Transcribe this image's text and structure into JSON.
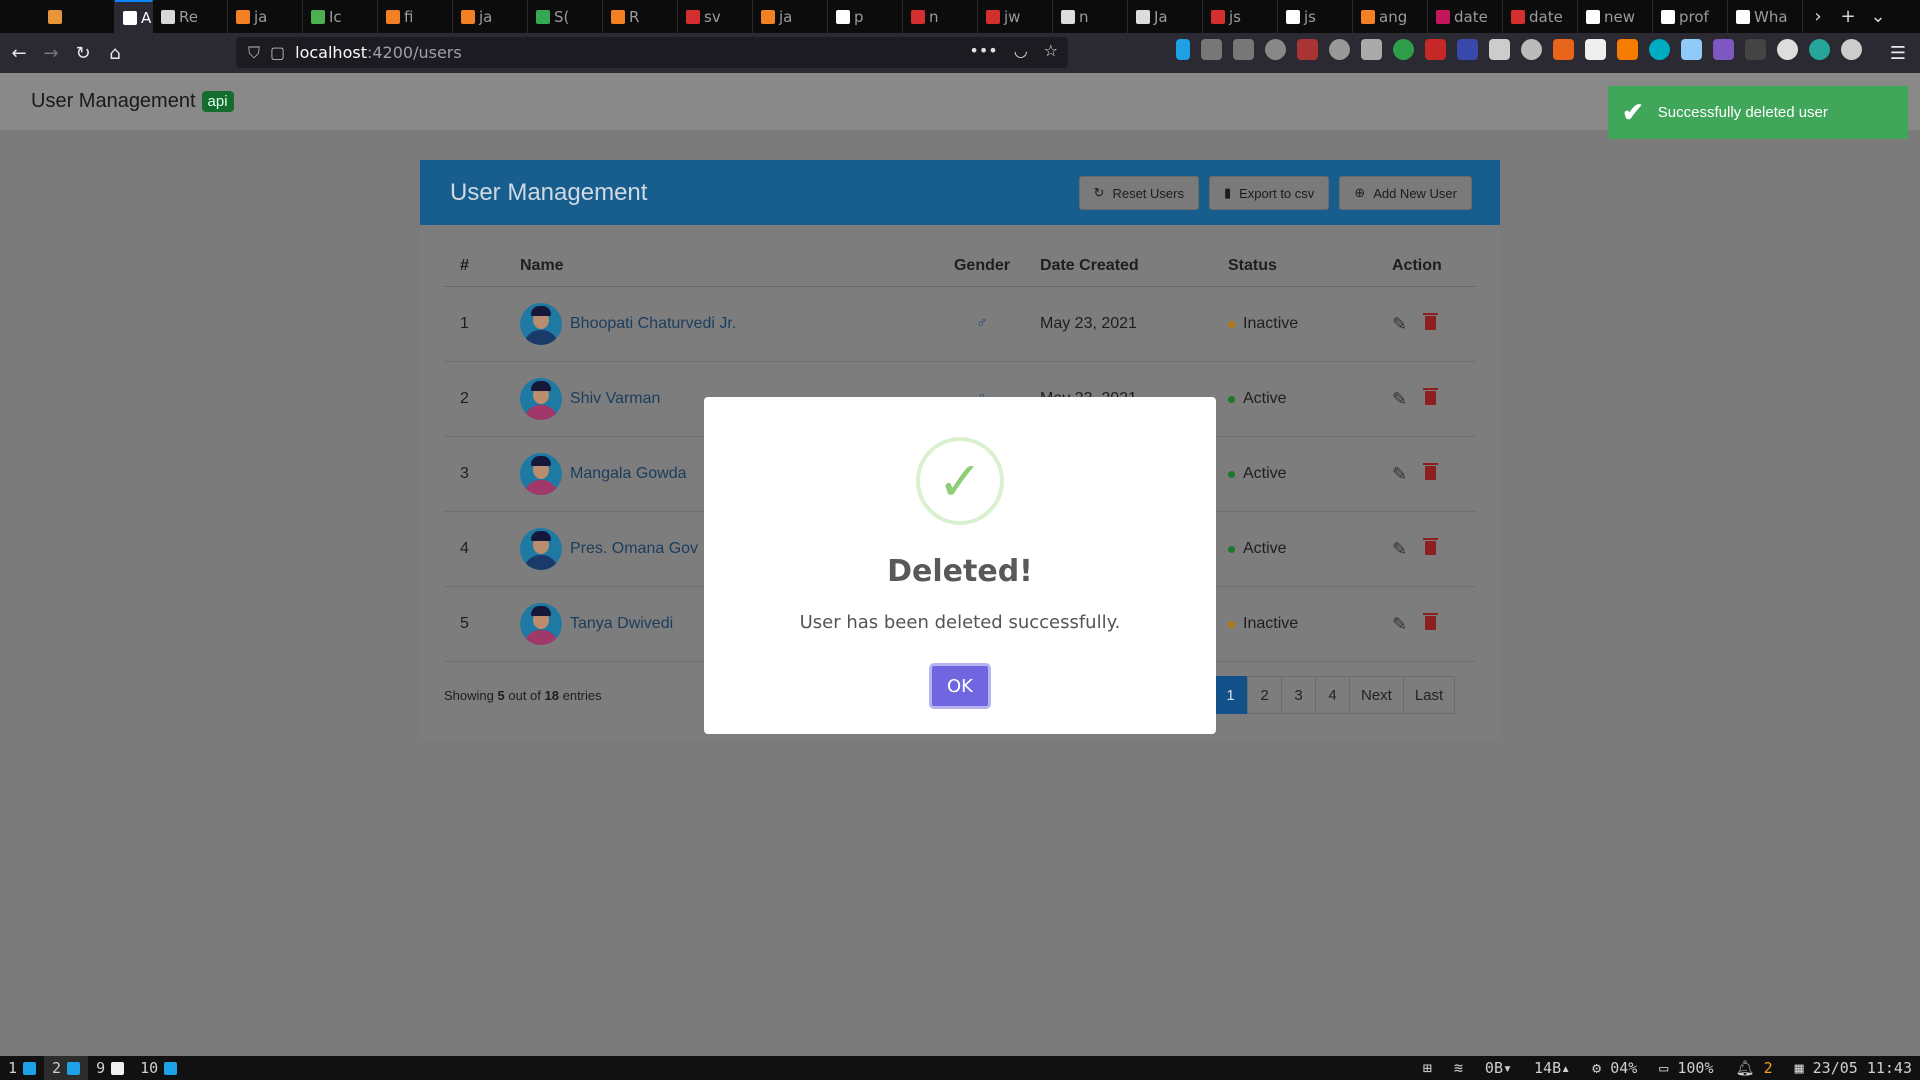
{
  "browser": {
    "tabs": [
      {
        "icon": "arch-icon",
        "color": "#e8953a",
        "label": ""
      },
      {
        "icon": "angular-icon",
        "color": "#ffffff",
        "label": "A",
        "active": true
      },
      {
        "icon": "back-tab-icon",
        "color": "#d8d8d8",
        "label": "Re"
      },
      {
        "icon": "stackoverflow-icon",
        "color": "#f48024",
        "label": "ja"
      },
      {
        "icon": "colorful-icon",
        "color": "#4caf50",
        "label": "Ic"
      },
      {
        "icon": "stackoverflow-icon",
        "color": "#f48024",
        "label": "fi"
      },
      {
        "icon": "stackoverflow-icon",
        "color": "#f48024",
        "label": "ja"
      },
      {
        "icon": "w3-icon",
        "color": "#34a853",
        "label": "S("
      },
      {
        "icon": "stackoverflow-icon",
        "color": "#f48024",
        "label": "R"
      },
      {
        "icon": "red-icon",
        "color": "#d32f2f",
        "label": "sv"
      },
      {
        "icon": "stackoverflow-icon",
        "color": "#f48024",
        "label": "ja"
      },
      {
        "icon": "google-icon",
        "color": "#ffffff",
        "label": "p"
      },
      {
        "icon": "red-icon",
        "color": "#d32f2f",
        "label": "n"
      },
      {
        "icon": "red-icon",
        "color": "#d32f2f",
        "label": "jw"
      },
      {
        "icon": "doc-icon",
        "color": "#dddddd",
        "label": "n"
      },
      {
        "icon": "doc-icon",
        "color": "#dddddd",
        "label": "Ja"
      },
      {
        "icon": "red-icon",
        "color": "#d32f2f",
        "label": "js"
      },
      {
        "icon": "google-icon",
        "color": "#ffffff",
        "label": "js"
      },
      {
        "icon": "stackoverflow-icon",
        "color": "#f48024",
        "label": "ang"
      },
      {
        "icon": "date-icon",
        "color": "#c2185b",
        "label": "date"
      },
      {
        "icon": "red-icon",
        "color": "#d32f2f",
        "label": "date"
      },
      {
        "icon": "google-icon",
        "color": "#ffffff",
        "label": "new"
      },
      {
        "icon": "google-icon",
        "color": "#ffffff",
        "label": "prof"
      },
      {
        "icon": "notion-icon",
        "color": "#ffffff",
        "label": "Wha"
      }
    ],
    "url_host": "localhost",
    "url_path": ":4200/users"
  },
  "app": {
    "brand": "User Management",
    "badge": "api"
  },
  "toast": {
    "text": "Successfully deleted user",
    "color": "#3fa65a"
  },
  "card": {
    "title": "User Management",
    "buttons": {
      "reset": "Reset Users",
      "export": "Export to csv",
      "add": "Add New User"
    }
  },
  "table": {
    "headers": {
      "num": "#",
      "name": "Name",
      "gender": "Gender",
      "date": "Date Created",
      "status": "Status",
      "action": "Action"
    },
    "rows": [
      {
        "num": "1",
        "name": "Bhoopati Chaturvedi Jr.",
        "gender": "♂",
        "date": "May 23, 2021",
        "status": "Inactive",
        "avatar": "male"
      },
      {
        "num": "2",
        "name": "Shiv Varman",
        "gender": "♀",
        "date": "May 23, 2021",
        "status": "Active",
        "avatar": "female"
      },
      {
        "num": "3",
        "name": "Mangala Gowda",
        "gender": "",
        "date": "",
        "status": "Active",
        "avatar": "female"
      },
      {
        "num": "4",
        "name": "Pres. Omana Gov",
        "gender": "",
        "date": "",
        "status": "Active",
        "avatar": "male"
      },
      {
        "num": "5",
        "name": "Tanya Dwivedi",
        "gender": "",
        "date": "",
        "status": "Inactive",
        "avatar": "female"
      }
    ]
  },
  "footer": {
    "showing_prefix": "Showing",
    "showing_count": "5",
    "showing_mid": "out of",
    "showing_total": "18",
    "showing_suffix": "entries"
  },
  "pagination": {
    "pages": [
      "1",
      "2",
      "3",
      "4"
    ],
    "current": "1",
    "next": "Next",
    "last": "Last"
  },
  "modal": {
    "title": "Deleted!",
    "text": "User has been deleted successfully.",
    "ok": "OK"
  },
  "sysbar": {
    "workspaces": [
      {
        "num": "1",
        "current": false
      },
      {
        "num": "2",
        "current": true
      },
      {
        "num": "9",
        "current": false
      },
      {
        "num": "10",
        "current": false
      }
    ],
    "net_down": "0B▾",
    "net_up": "14B▴",
    "cpu": "04%",
    "battery": "100%",
    "notifications": "2",
    "datetime": "23/05 11:43"
  }
}
